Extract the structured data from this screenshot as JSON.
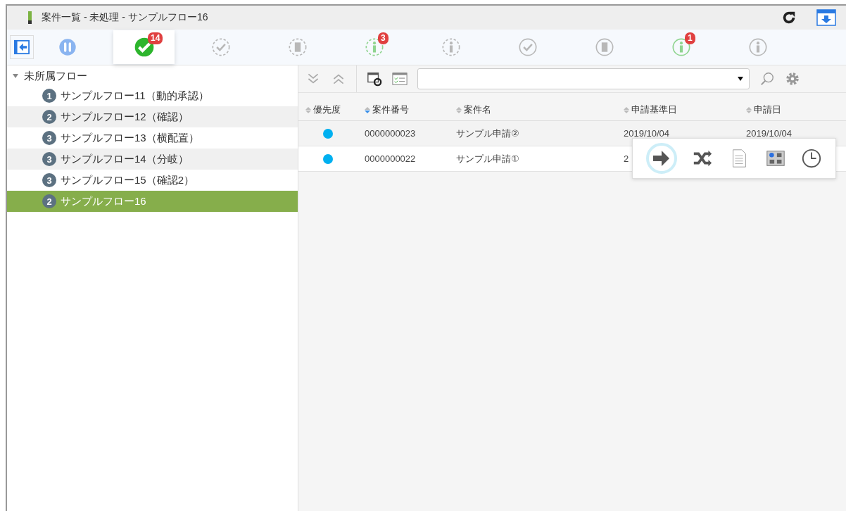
{
  "window": {
    "title": "案件一覧 - 未処理 - サンプルフロー16"
  },
  "tabs": [
    {
      "kind": "pause",
      "selected": false
    },
    {
      "kind": "check-solid",
      "selected": true,
      "badge": "14"
    },
    {
      "kind": "check-dashed",
      "selected": false
    },
    {
      "kind": "doc-dashed",
      "selected": false
    },
    {
      "kind": "info-dashed-green",
      "selected": false,
      "badge": "3"
    },
    {
      "kind": "info-dashed",
      "selected": false
    },
    {
      "kind": "check",
      "selected": false
    },
    {
      "kind": "doc",
      "selected": false
    },
    {
      "kind": "info-green",
      "selected": false,
      "badge": "1"
    },
    {
      "kind": "info",
      "selected": false
    }
  ],
  "sidebar": {
    "tree": {
      "label": "未所属フロー",
      "expanded": true,
      "children": [
        {
          "count": "1",
          "label": "サンプルフロー11（動的承認）",
          "selected": false
        },
        {
          "count": "2",
          "label": "サンプルフロー12（確認）",
          "selected": false
        },
        {
          "count": "3",
          "label": "サンプルフロー13（横配置）",
          "selected": false
        },
        {
          "count": "3",
          "label": "サンプルフロー14（分岐）",
          "selected": false
        },
        {
          "count": "3",
          "label": "サンプルフロー15（確認2）",
          "selected": false
        },
        {
          "count": "2",
          "label": "サンプルフロー16",
          "selected": true
        }
      ]
    }
  },
  "table": {
    "columns": [
      {
        "label": "優先度",
        "sorted": false
      },
      {
        "label": "案件番号",
        "sorted": true
      },
      {
        "label": "案件名",
        "sorted": false
      },
      {
        "label": "申請基準日",
        "sorted": false
      },
      {
        "label": "申請日",
        "sorted": false
      }
    ],
    "rows": [
      {
        "color": "#00b0f0",
        "number": "0000000023",
        "name": "サンプル申請②",
        "base_date": "2019/10/04",
        "date": "2019/10/04",
        "selected": true
      },
      {
        "color": "#00b0f0",
        "number": "0000000022",
        "name": "サンプル申請①",
        "base_date": "2",
        "selected": false
      }
    ]
  }
}
